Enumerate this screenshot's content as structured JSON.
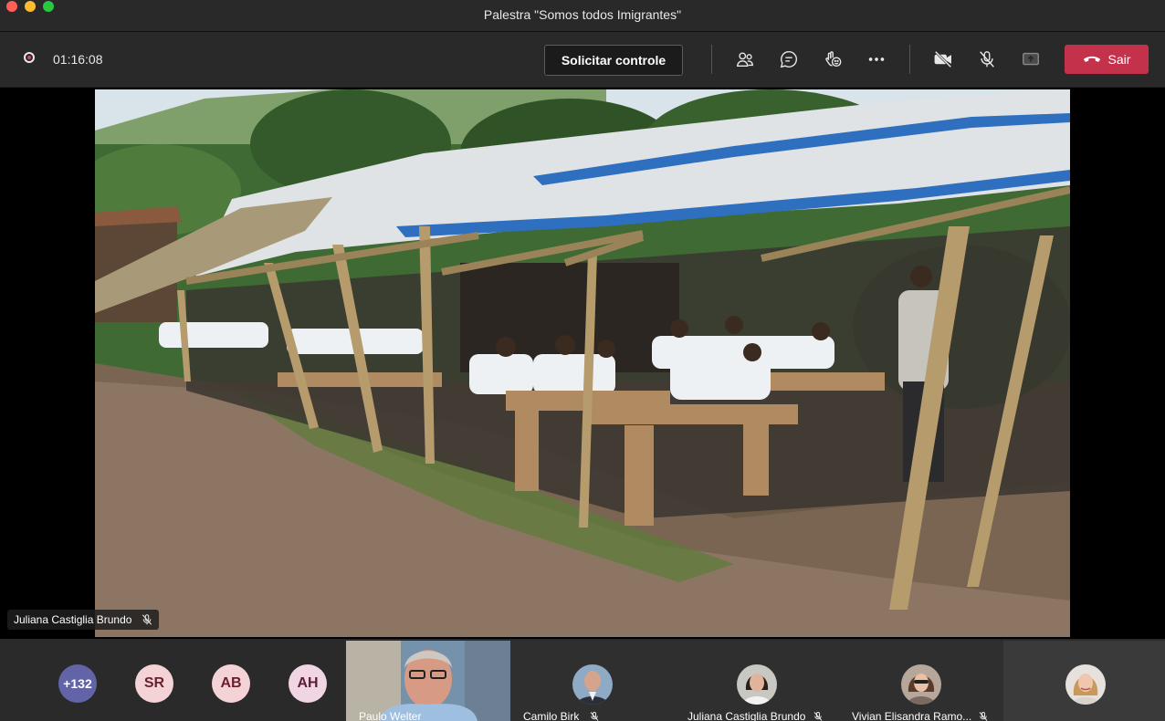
{
  "window": {
    "title": "Palestra \"Somos todos Imigrantes\""
  },
  "toolbar": {
    "timer": "01:16:08",
    "request_control_label": "Solicitar controle",
    "leave_label": "Sair"
  },
  "stage": {
    "presenter_name": "Juliana Castiglia Brundo"
  },
  "strip": {
    "overflow_count": "+132",
    "avatars": [
      {
        "initials": "SR",
        "bg": "#f3d3d6",
        "fg": "#6b1f2b"
      },
      {
        "initials": "AB",
        "bg": "#f3d3d6",
        "fg": "#6b1f2b"
      },
      {
        "initials": "AH",
        "bg": "#f0d6e2",
        "fg": "#5d1d3a"
      }
    ],
    "participants": [
      {
        "name": "Paulo Welter"
      },
      {
        "name": "Camilo Birk"
      },
      {
        "name": "Juliana Castiglia Brundo"
      },
      {
        "name": "Vivian Elisandra Ramo..."
      }
    ]
  },
  "colors": {
    "leave": "#c4314b",
    "overflow_avatar": "#6264a7"
  }
}
